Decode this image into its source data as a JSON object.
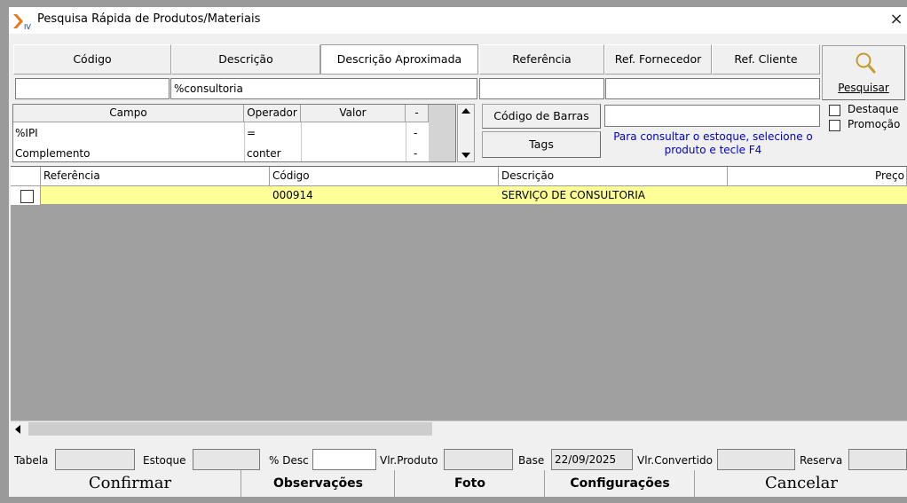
{
  "window": {
    "title": "Pesquisa Rápida de Produtos/Materiais",
    "close": "×"
  },
  "tabs": [
    "Código",
    "Descrição",
    "Descrição Aproximada",
    "Referência",
    "Ref. Fornecedor",
    "Ref. Cliente"
  ],
  "search_values": [
    "",
    "%consultoria",
    "",
    "",
    ""
  ],
  "search_button": "Pesquisar",
  "filter_table": {
    "headers": [
      "Campo",
      "Operador",
      "Valor",
      "-"
    ],
    "rows": [
      {
        "campo": "%IPI",
        "operador": "=",
        "valor": "",
        "x": "-"
      },
      {
        "campo": "Complemento",
        "operador": "conter",
        "valor": "",
        "x": "-"
      }
    ]
  },
  "barcode_button": "Código de Barras",
  "barcode_value": "",
  "tags_button": "Tags",
  "stock_hint": "Para consultar o estoque, selecione o produto e tecle F4",
  "options": {
    "destaque": "Destaque",
    "promocao": "Promoção"
  },
  "grid": {
    "headers": [
      "Referência",
      "Código",
      "Descrição",
      "Preço"
    ],
    "rows": [
      {
        "referencia": "",
        "codigo": "000914",
        "descricao": "SERVIÇO DE CONSULTORIA",
        "preco": ""
      }
    ]
  },
  "status": {
    "tabela": "Tabela",
    "tabela_value": "",
    "estoque": "Estoque",
    "estoque_value": "",
    "desc": "% Desc",
    "desc_value": "",
    "vlr_produto": "Vlr.Produto",
    "vlr_produto_value": "",
    "base": "Base",
    "base_value": "22/09/2025",
    "vlr_convertido": "Vlr.Convertido",
    "vlr_convertido_value": "",
    "reserva": "Reserva",
    "reserva_value": ""
  },
  "actions": {
    "confirmar": "Confirmar",
    "observacoes": "Observações",
    "foto": "Foto",
    "configuracoes": "Configurações",
    "cancelar": "Cancelar"
  },
  "colors": {
    "selected_row": "#ffff99",
    "grid_bg": "#a0a0a0",
    "hint": "#0000c8",
    "logo": "#e87a1c"
  }
}
